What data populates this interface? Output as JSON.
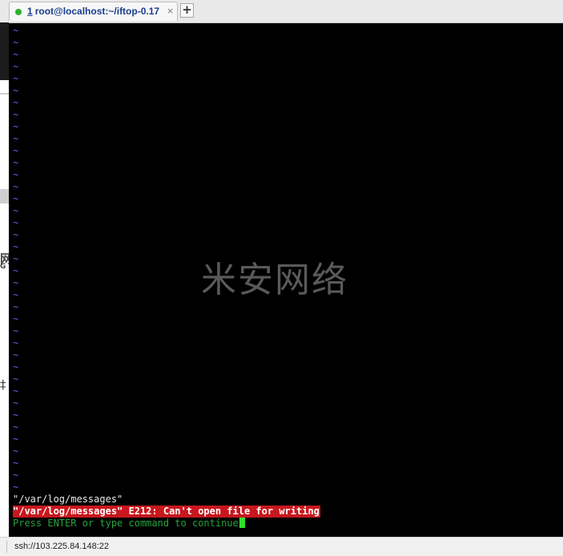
{
  "tab": {
    "number": "1",
    "title": "root@localhost:~/iftop-0.17",
    "close_glyph": "×",
    "status_color": "#2fb12f"
  },
  "add_tab_glyph": "+",
  "side_fragments": {
    "char_1": "网",
    "char_2": "G",
    "char_3": "‡"
  },
  "terminal": {
    "empty_line_marker": "~",
    "empty_line_count": 39,
    "watermark": "米安网络",
    "lines": {
      "file_line": "\"/var/log/messages\"",
      "error_line": "\"/var/log/messages\" E212: Can't open file for writing",
      "prompt_line": "Press ENTER or type command to continue"
    },
    "colors": {
      "background": "#000000",
      "tilde": "#4a6fd8",
      "error_bg": "#c8171e",
      "prompt": "#24a33c",
      "cursor": "#2fe02f"
    }
  },
  "status": {
    "connection": "ssh://103.225.84.148:22"
  }
}
